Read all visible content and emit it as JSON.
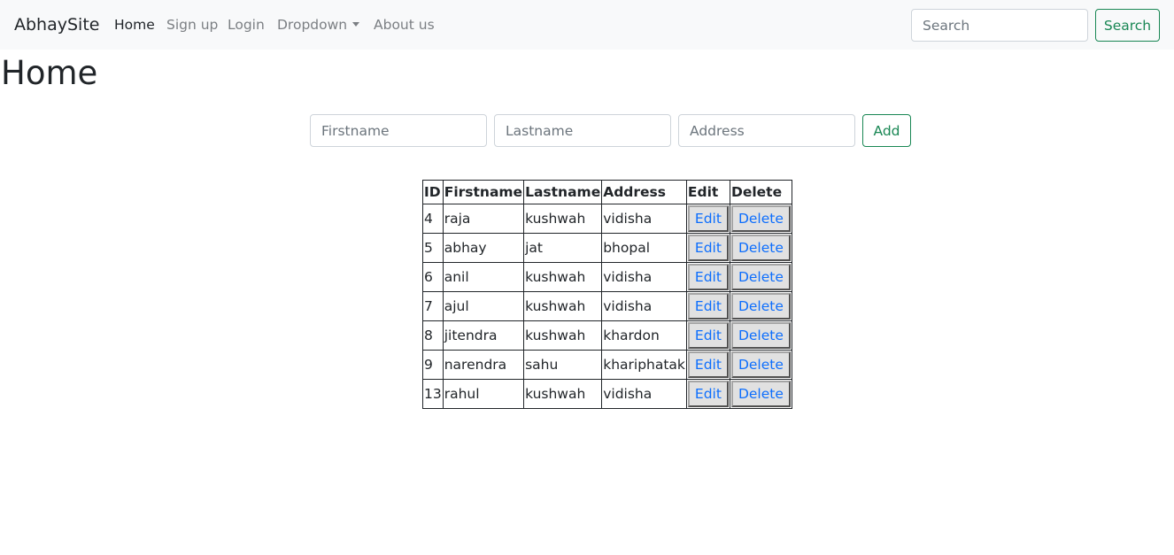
{
  "navbar": {
    "brand": "AbhaySite",
    "items": [
      {
        "label": "Home"
      },
      {
        "label": "Sign up"
      },
      {
        "label": "Login"
      },
      {
        "label": "Dropdown"
      },
      {
        "label": "About us"
      }
    ],
    "search_placeholder": "Search",
    "search_button": "Search"
  },
  "page": {
    "title": "Home"
  },
  "form": {
    "firstname_placeholder": "Firstname",
    "lastname_placeholder": "Lastname",
    "address_placeholder": "Address",
    "add_button": "Add"
  },
  "table": {
    "headers": [
      "ID",
      "Firstname",
      "Lastname",
      "Address",
      "Edit",
      "Delete"
    ],
    "edit_label": "Edit",
    "delete_label": "Delete",
    "rows": [
      {
        "id": "4",
        "firstname": "raja",
        "lastname": "kushwah",
        "address": "vidisha"
      },
      {
        "id": "5",
        "firstname": "abhay",
        "lastname": "jat",
        "address": "bhopal"
      },
      {
        "id": "6",
        "firstname": "anil",
        "lastname": "kushwah",
        "address": "vidisha"
      },
      {
        "id": "7",
        "firstname": "ajul",
        "lastname": "kushwah",
        "address": "vidisha"
      },
      {
        "id": "8",
        "firstname": "jitendra",
        "lastname": "kushwah",
        "address": "khardon"
      },
      {
        "id": "9",
        "firstname": "narendra",
        "lastname": "sahu",
        "address": "khariphatak"
      },
      {
        "id": "13",
        "firstname": "rahul",
        "lastname": "kushwah",
        "address": "vidisha"
      }
    ]
  },
  "colors": {
    "navbar_bg": "#f8f9fa",
    "success": "#198754",
    "link_blue": "#0d6efd"
  }
}
